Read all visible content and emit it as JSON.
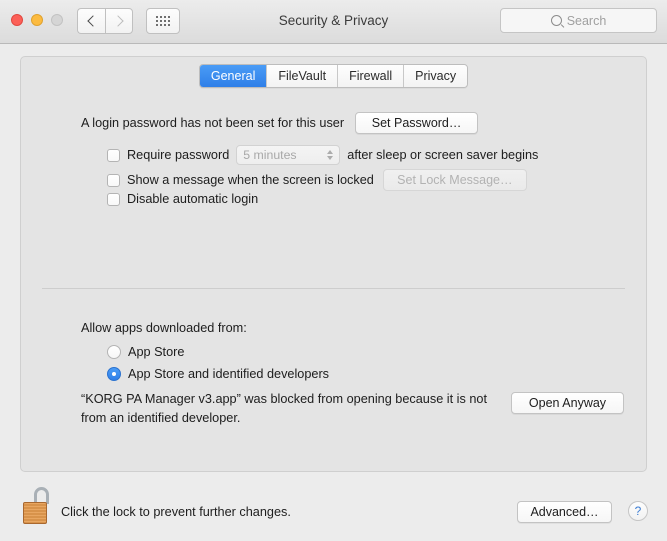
{
  "window": {
    "title": "Security & Privacy",
    "traffic_lights": [
      "close",
      "minimize",
      "zoom"
    ]
  },
  "toolbar": {
    "back_icon": "chevron-left-icon",
    "forward_icon": "chevron-right-icon",
    "showall_icon": "grid-icon",
    "search": {
      "placeholder": "Search",
      "icon": "search-icon",
      "value": ""
    }
  },
  "tabs": [
    {
      "label": "General",
      "active": true
    },
    {
      "label": "FileVault",
      "active": false
    },
    {
      "label": "Firewall",
      "active": false
    },
    {
      "label": "Privacy",
      "active": false
    }
  ],
  "general": {
    "password_status": "A login password has not been set for this user",
    "set_password_button": "Set Password…",
    "require_password": {
      "label": "Require password",
      "checked": false,
      "delay_value": "5 minutes",
      "delay_enabled": false,
      "suffix": "after sleep or screen saver begins"
    },
    "show_message": {
      "label": "Show a message when the screen is locked",
      "checked": false,
      "button": "Set Lock Message…",
      "button_enabled": false
    },
    "disable_auto_login": {
      "label": "Disable automatic login",
      "checked": false
    }
  },
  "gatekeeper": {
    "heading": "Allow apps downloaded from:",
    "options": [
      {
        "label": "App Store",
        "selected": false
      },
      {
        "label": "App Store and identified developers",
        "selected": true
      }
    ],
    "blocked_message": "“KORG PA Manager v3.app” was blocked from opening because it is not from an identified developer.",
    "open_anyway_button": "Open Anyway"
  },
  "footer": {
    "lock_icon": "unlocked-padlock-icon",
    "lock_caption": "Click the lock to prevent further changes.",
    "advanced_button": "Advanced…",
    "help_button": "?"
  },
  "colors": {
    "accent_blue": "#2f7fe8",
    "window_bg": "#ececec",
    "panel_bg": "#e4e4e4",
    "lock_gold": "#d8934b"
  }
}
